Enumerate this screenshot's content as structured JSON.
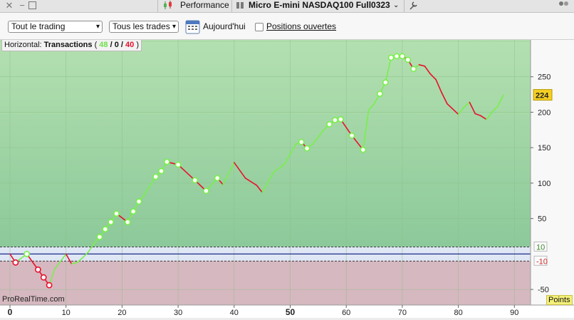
{
  "top_bar": {
    "performance_label": "Performance",
    "instrument_label": "Micro E-mini NASDAQ100 Full0323"
  },
  "toolbar": {
    "trading_select": "Tout le trading",
    "trades_select": "Tous les trades",
    "date_label": "Aujourd'hui",
    "open_positions_label": "Positions ouvertes",
    "open_positions_checked": false
  },
  "legend": {
    "prefix": "Horizontal:",
    "name": "Transactions",
    "open": "(",
    "wins": "48",
    "slash1": "/",
    "neutral": "0",
    "slash2": "/",
    "losses": "40",
    "close": ")"
  },
  "watermark": "ProRealTime.com",
  "units_badge": "Points",
  "colors": {
    "gain_line": "#78f04a",
    "loss_line": "#e8102c",
    "profit_bg": "#9fd49e",
    "loss_bg": "#d6b8c0",
    "current_badge": "#f5cf24",
    "units_badge": "#f4f07a"
  },
  "chart_data": {
    "type": "line",
    "x_ticks": [
      "0",
      "10",
      "20",
      "30",
      "40",
      "50",
      "60",
      "70",
      "80",
      "90"
    ],
    "y_ticks": [
      "250",
      "200",
      "150",
      "100",
      "50",
      "-50"
    ],
    "xlim": [
      0,
      92
    ],
    "ylim": [
      -72,
      302
    ],
    "threshold_levels": [
      10,
      -10
    ],
    "threshold_labels": [
      "10",
      "-10"
    ],
    "current_value": "224",
    "grid": true,
    "x": [
      0,
      1,
      3,
      5,
      6,
      7,
      8,
      10,
      11,
      12,
      13,
      14,
      15,
      16,
      17,
      18,
      19,
      21,
      22,
      23,
      24,
      25,
      26,
      27,
      28,
      30,
      33,
      35,
      37,
      38,
      40,
      42,
      44,
      45,
      47,
      49,
      50,
      51,
      52,
      53,
      54,
      55,
      56,
      57,
      58,
      59,
      61,
      63,
      64,
      65,
      66,
      67,
      68,
      69,
      70,
      71,
      72,
      73,
      74,
      75,
      76,
      77,
      78,
      80,
      81,
      82,
      83,
      84,
      85,
      86,
      87,
      88
    ],
    "y": [
      0,
      -12,
      0,
      -22,
      -33,
      -44,
      -21,
      0,
      -14,
      -12,
      -5,
      3,
      15,
      24,
      35,
      45,
      57,
      45,
      60,
      74,
      84,
      97,
      109,
      117,
      130,
      126,
      104,
      89,
      107,
      98,
      129,
      107,
      97,
      87,
      115,
      127,
      141,
      155,
      158,
      149,
      155,
      165,
      175,
      183,
      189,
      190,
      167,
      147,
      203,
      212,
      226,
      242,
      277,
      279,
      279,
      274,
      261,
      267,
      265,
      254,
      246,
      228,
      212,
      197,
      207,
      214,
      198,
      195,
      190,
      200,
      208,
      224
    ],
    "circle_indices": [
      1,
      2,
      3,
      4,
      5,
      13,
      14,
      15,
      16,
      17,
      18,
      19,
      22,
      23,
      24,
      25,
      26,
      27,
      28,
      38,
      39,
      43,
      44,
      45,
      46,
      47,
      50,
      51,
      52,
      53,
      54,
      55,
      56
    ]
  }
}
